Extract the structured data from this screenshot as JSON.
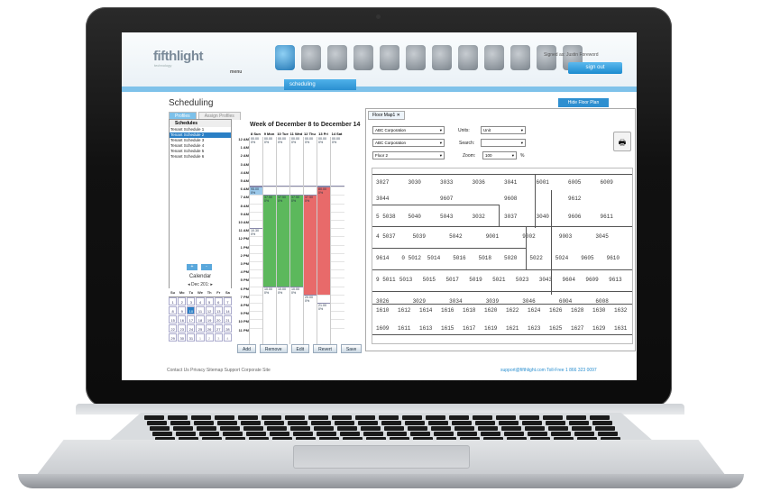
{
  "header": {
    "logo_main": "fifthlight",
    "logo_sub": "technology",
    "menu_label": "menu",
    "signed_in": "Signed as: Justin Foreword",
    "sign_out": "sign out",
    "active_tab": "scheduling"
  },
  "page": {
    "title": "Scheduling",
    "hide_floor_plan": "Hide Floor Plan",
    "tabs": [
      "Profiles",
      "Assign Profiles"
    ]
  },
  "schedules": {
    "header": "Schedules",
    "items": [
      "Tenant Schedule 1",
      "Tenant Schedule 2",
      "Tenant Schedule 3",
      "Tenant Schedule 4",
      "Tenant Schedule 5",
      "Tenant Schedule 6"
    ],
    "selected_index": 1,
    "add": "+",
    "remove": "-"
  },
  "calendar": {
    "label": "Calendar",
    "nav": "◂ Dec 201: ▸",
    "weekdays": [
      "Su",
      "Mo",
      "Tu",
      "We",
      "Th",
      "Fr",
      "Sa"
    ],
    "days": [
      "1",
      "2",
      "3",
      "4",
      "5",
      "6",
      "7",
      "8",
      "9",
      "10",
      "11",
      "12",
      "13",
      "14",
      "15",
      "16",
      "17",
      "18",
      "19",
      "20",
      "21",
      "22",
      "23",
      "24",
      "25",
      "26",
      "27",
      "28",
      "29",
      "30",
      "31",
      "1",
      "2",
      "3",
      "4"
    ],
    "today": "10"
  },
  "week": {
    "title": "Week of December 8 to December 14",
    "days": [
      "8 Sun",
      "9 Mon",
      "10 Tue",
      "11 Wed",
      "12 Thu",
      "13 Fri",
      "14 Sat"
    ],
    "hours": [
      "12 AM",
      "1 AM",
      "2 AM",
      "3 AM",
      "4 AM",
      "5 AM",
      "6 AM",
      "7 AM",
      "8 AM",
      "9 AM",
      "10 AM",
      "11 AM",
      "12 PM",
      "1 PM",
      "2 PM",
      "3 PM",
      "4 PM",
      "5 PM",
      "6 PM",
      "7 PM",
      "8 PM",
      "9 PM",
      "10 PM",
      "11 PM"
    ],
    "top_value": "00.00",
    "top_pct": "0%",
    "buttons": [
      "Add",
      "Remove",
      "Edit",
      "Revert",
      "Save"
    ],
    "blocks": [
      {
        "col": 0,
        "start": 6,
        "end": 7,
        "label": "95.00",
        "color": "#9cc9ea"
      },
      {
        "col": 0,
        "start": 11,
        "end": 12,
        "label": "10.30",
        "color": "#fff"
      },
      {
        "col": 1,
        "start": 7,
        "end": 18,
        "label": "37.50",
        "color": "#5cb85c"
      },
      {
        "col": 2,
        "start": 7,
        "end": 18,
        "label": "37.50",
        "color": "#5cb85c"
      },
      {
        "col": 3,
        "start": 7,
        "end": 18,
        "label": "37.50",
        "color": "#5cb85c"
      },
      {
        "col": 4,
        "start": 7,
        "end": 19,
        "label": "37.50",
        "color": "#e86a6a"
      },
      {
        "col": 5,
        "start": 6,
        "end": 19,
        "label": "80.00",
        "color": "#e86a6a"
      },
      {
        "col": 1,
        "start": 18,
        "end": 24,
        "label": "10.00",
        "color": "#fff"
      },
      {
        "col": 2,
        "start": 18,
        "end": 24,
        "label": "10.00",
        "color": "#fff"
      },
      {
        "col": 3,
        "start": 18,
        "end": 24,
        "label": "10.00",
        "color": "#fff"
      },
      {
        "col": 4,
        "start": 19,
        "end": 24,
        "label": "20.00",
        "color": "#fff"
      },
      {
        "col": 5,
        "start": 20,
        "end": 24,
        "label": "21.00",
        "color": "#fff"
      }
    ]
  },
  "floormap": {
    "tab": "Floor Map1",
    "company1": "ABC Corporation",
    "company2": "ABC Corporation",
    "floor": "Floor 2",
    "units_label": "Units:",
    "units_value": "Unit",
    "search_label": "Search:",
    "zoom_label": "Zoom:",
    "zoom_value": "100",
    "zoom_unit": "%",
    "rooms": [
      "3027",
      "3030",
      "3033",
      "3036",
      "3041",
      "6001",
      "6005",
      "6009",
      "3044",
      "9607",
      "9608",
      "9612",
      "5 5038",
      "5040",
      "5043",
      "3032",
      "3037",
      "3040",
      "9606",
      "9611",
      "4 5037",
      "5039",
      "5042",
      "9001",
      "9002",
      "9003",
      "3045",
      "9614",
      "0 5012",
      "5014",
      "5016",
      "5018",
      "5020",
      "5022",
      "5024",
      "9605",
      "9610",
      "9 5011",
      "5013",
      "5015",
      "5017",
      "5019",
      "5021",
      "5023",
      "3043",
      "9604",
      "9609",
      "9613",
      "3026",
      "3029",
      "3034",
      "3039",
      "3046",
      "6004",
      "6008",
      "1610",
      "1612",
      "1614",
      "1616",
      "1618",
      "1620",
      "1622",
      "1624",
      "1626",
      "1628",
      "1630",
      "1632",
      "1609",
      "1611",
      "1613",
      "1615",
      "1617",
      "1619",
      "1621",
      "1623",
      "1625",
      "1627",
      "1629",
      "1631"
    ]
  },
  "footer": {
    "links": "Contact Us  Privacy  Sitemap  Support  Corporate Site",
    "support": "support@fifthlight.com Toll-Free 1 866 323 0097"
  }
}
